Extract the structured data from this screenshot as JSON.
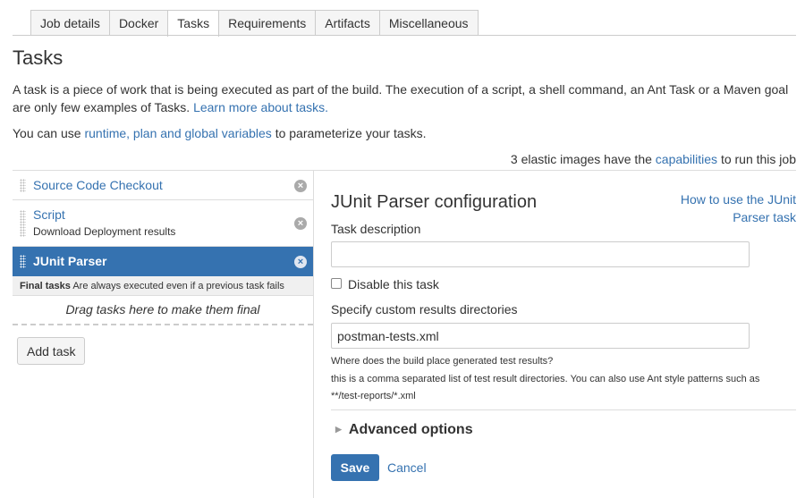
{
  "tabs": [
    {
      "label": "Job details",
      "active": false
    },
    {
      "label": "Docker",
      "active": false
    },
    {
      "label": "Tasks",
      "active": true
    },
    {
      "label": "Requirements",
      "active": false
    },
    {
      "label": "Artifacts",
      "active": false
    },
    {
      "label": "Miscellaneous",
      "active": false
    }
  ],
  "page": {
    "title": "Tasks",
    "intro_text": "A task is a piece of work that is being executed as part of the build. The execution of a script, a shell command, an Ant Task or a Maven goal are only few examples of Tasks.",
    "intro_link": "Learn more about tasks.",
    "vars_prefix": "You can use",
    "vars_link": "runtime, plan and global variables",
    "vars_suffix": "to parameterize your tasks.",
    "cap_prefix": "3 elastic images have the",
    "cap_link": "capabilities",
    "cap_suffix": "to run this job"
  },
  "task_list": {
    "items": [
      {
        "label": "Source Code Checkout",
        "sub": ""
      },
      {
        "label": "Script",
        "sub": "Download Deployment results"
      },
      {
        "label": "JUnit Parser",
        "sub": ""
      }
    ],
    "final_title": "Final tasks",
    "final_desc": "Are always executed even if a previous task fails",
    "drop_text": "Drag tasks here to make them final",
    "add_task": "Add task",
    "remove_icon": "close-circle-icon",
    "grip_icon": "drag-handle-icon"
  },
  "config": {
    "title": "JUnit Parser configuration",
    "howto_link": "How to use the JUnit Parser task",
    "desc_label": "Task description",
    "desc_value": "",
    "disable_label": "Disable this task",
    "disable_checked": false,
    "dirs_label": "Specify custom results directories",
    "dirs_value": "postman-tests.xml",
    "help_line1": "Where does the build place generated test results?",
    "help_line2": "this is a comma separated list of test result directories. You can also use Ant style patterns such as",
    "help_line3": "**/test-reports/*.xml",
    "advanced": "Advanced options",
    "save": "Save",
    "cancel": "Cancel"
  },
  "colors": {
    "accent": "#3572b0",
    "border": "#dddddd"
  }
}
